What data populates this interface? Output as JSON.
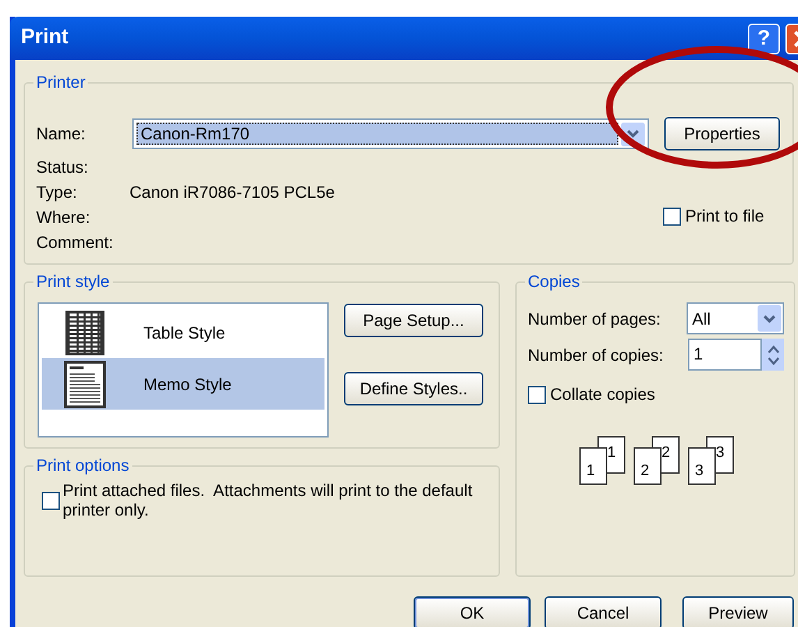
{
  "window": {
    "title": "Print",
    "help_button": "?"
  },
  "printer": {
    "group_title": "Printer",
    "name_label": "Name:",
    "name_value": "Canon-Rm170",
    "properties_button": "Properties",
    "fields": [
      {
        "label": "Status:"
      },
      {
        "label": "Type:",
        "value": "Canon iR7086-7105 PCL5e"
      },
      {
        "label": "Where:"
      },
      {
        "label": "Comment:"
      }
    ],
    "print_to_file": {
      "label": "Print to file",
      "checked": false
    }
  },
  "print_style": {
    "group_title": "Print style",
    "styles": [
      {
        "label": "Table Style",
        "kind": "table",
        "selected": false
      },
      {
        "label": "Memo Style",
        "kind": "memo",
        "selected": true
      }
    ],
    "buttons": [
      "Page Setup...",
      "Define Styles.."
    ]
  },
  "print_options": {
    "group_title": "Print options",
    "attach_files": {
      "label": "Print attached files.  Attachments will print to the default printer only.",
      "checked": false
    }
  },
  "copies": {
    "group_title": "Copies",
    "pages_label": "Number of pages:",
    "pages_value": "All",
    "copies_label": "Number of copies:",
    "copies_value": "1",
    "collate": {
      "label": "Collate copies",
      "checked": false
    },
    "stacks": [
      [
        "1",
        "1"
      ],
      [
        "2",
        "2"
      ],
      [
        "3",
        "3"
      ]
    ]
  },
  "buttons": [
    "OK",
    "Cancel",
    "Preview"
  ]
}
